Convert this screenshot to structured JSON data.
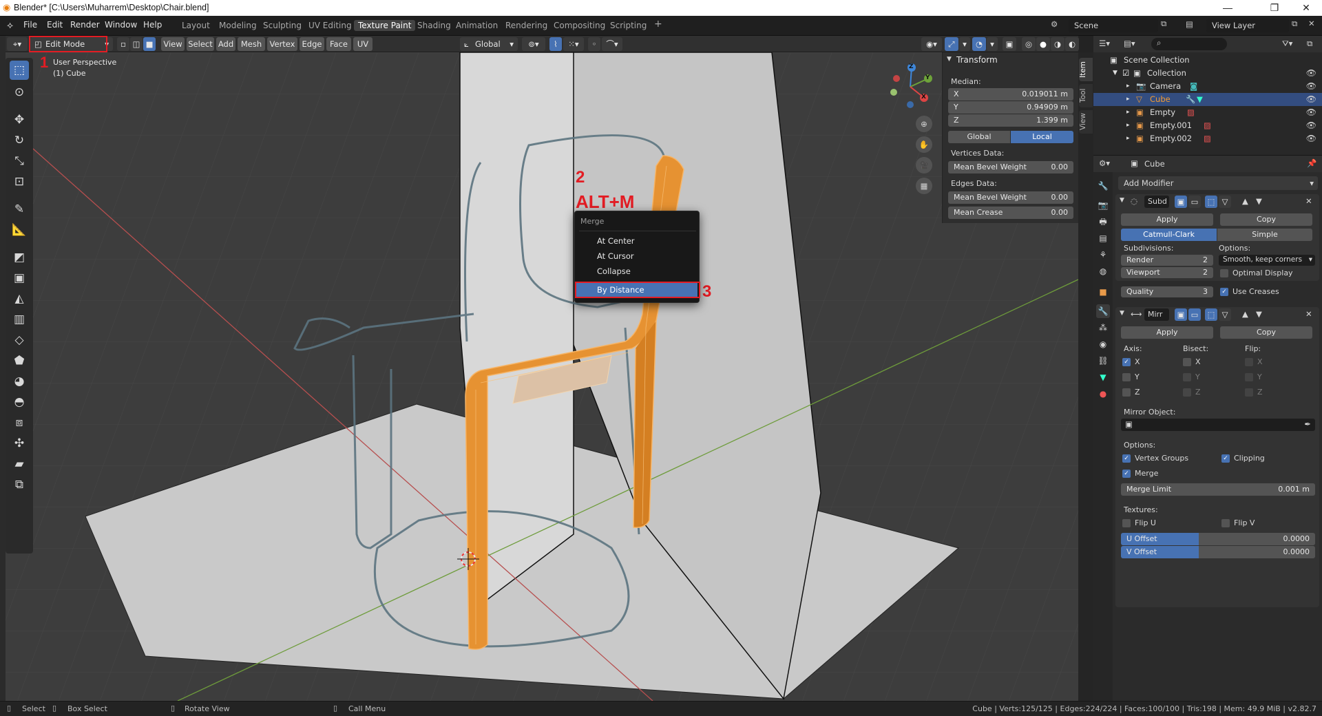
{
  "window": {
    "title": "Blender* [C:\\Users\\Muharrem\\Desktop\\Chair.blend]",
    "minimize": "—",
    "maximize": "❐",
    "close": "✕"
  },
  "menu": [
    "File",
    "Edit",
    "Render",
    "Window",
    "Help"
  ],
  "workspaces": [
    "Layout",
    "Modeling",
    "Sculpting",
    "UV Editing",
    "Texture Paint",
    "Shading",
    "Animation",
    "Rendering",
    "Compositing",
    "Scripting"
  ],
  "workspace_add": "+",
  "scene": {
    "label": "Scene",
    "view_layer": "View Layer"
  },
  "viewport_header": {
    "mode": "Edit Mode",
    "menus": [
      "View",
      "Select",
      "Add",
      "Mesh",
      "Vertex",
      "Edge",
      "Face",
      "UV"
    ],
    "orientation": "Global"
  },
  "viewport": {
    "perspective": "User Perspective",
    "object": "(1) Cube",
    "gizmo_axes": {
      "x": "X",
      "y": "Y",
      "z": "Z"
    }
  },
  "annotations": {
    "n1": "1",
    "n2": "2",
    "n3": "3",
    "shortcut": "ALT+M"
  },
  "merge_menu": {
    "title": "Merge",
    "items": [
      "At Center",
      "At Cursor",
      "Collapse",
      "By Distance"
    ],
    "active": "By Distance"
  },
  "npanel": {
    "header": "Transform",
    "median_label": "Median:",
    "x_label": "X",
    "x": "0.019011 m",
    "y_label": "Y",
    "y": "0.94909 m",
    "z_label": "Z",
    "z": "1.399 m",
    "global": "Global",
    "local": "Local",
    "vertices_data": "Vertices Data:",
    "mean_bevel_v_label": "Mean Bevel Weight",
    "mean_bevel_v": "0.00",
    "edges_data": "Edges Data:",
    "mean_bevel_e_label": "Mean Bevel Weight",
    "mean_bevel_e": "0.00",
    "mean_crease_label": "Mean Crease",
    "mean_crease": "0.00",
    "tabs": [
      "Item",
      "Tool",
      "View"
    ]
  },
  "outliner": {
    "rows": [
      {
        "label": "Scene Collection",
        "selected": false
      },
      {
        "label": "Collection",
        "selected": false
      },
      {
        "label": "Camera",
        "selected": false
      },
      {
        "label": "Cube",
        "selected": true
      },
      {
        "label": "Empty",
        "selected": false
      },
      {
        "label": "Empty.001",
        "selected": false
      },
      {
        "label": "Empty.002",
        "selected": false
      }
    ]
  },
  "properties": {
    "object": "Cube",
    "add_modifier": "Add Modifier",
    "subd": {
      "name": "Subd",
      "apply": "Apply",
      "copy": "Copy",
      "catmull": "Catmull-Clark",
      "simple": "Simple",
      "subdivisions": "Subdivisions:",
      "options": "Options:",
      "render_label": "Render",
      "render": "2",
      "viewport_label": "Viewport",
      "viewport": "2",
      "quality_label": "Quality",
      "quality": "3",
      "smooth": "Smooth, keep corners",
      "optimal": "Optimal Display",
      "use_creases": "Use Creases"
    },
    "mirr": {
      "name": "Mirr",
      "apply": "Apply",
      "copy": "Copy",
      "axis": "Axis:",
      "bisect": "Bisect:",
      "flip": "Flip:",
      "x": "X",
      "y": "Y",
      "z": "Z",
      "mirror_object": "Mirror Object:",
      "options": "Options:",
      "vertex_groups": "Vertex Groups",
      "clipping": "Clipping",
      "merge": "Merge",
      "merge_limit_label": "Merge Limit",
      "merge_limit": "0.001 m",
      "textures": "Textures:",
      "flip_u": "Flip U",
      "flip_v": "Flip V",
      "u_offset_label": "U Offset",
      "u_offset": "0.0000",
      "v_offset_label": "V Offset",
      "v_offset": "0.0000"
    }
  },
  "statusbar": {
    "select": "Select",
    "box_select": "Box Select",
    "rotate_view": "Rotate View",
    "call_menu": "Call Menu",
    "stats": "Cube | Verts:125/125 | Edges:224/224 | Faces:100/100 | Tris:198 | Mem: 49.9 MiB | v2.82.7"
  },
  "colors": {
    "accent": "#4772b3",
    "selection_orange": "#f29b34",
    "annotation_red": "#e31c23",
    "background": "#3d3d3d"
  }
}
